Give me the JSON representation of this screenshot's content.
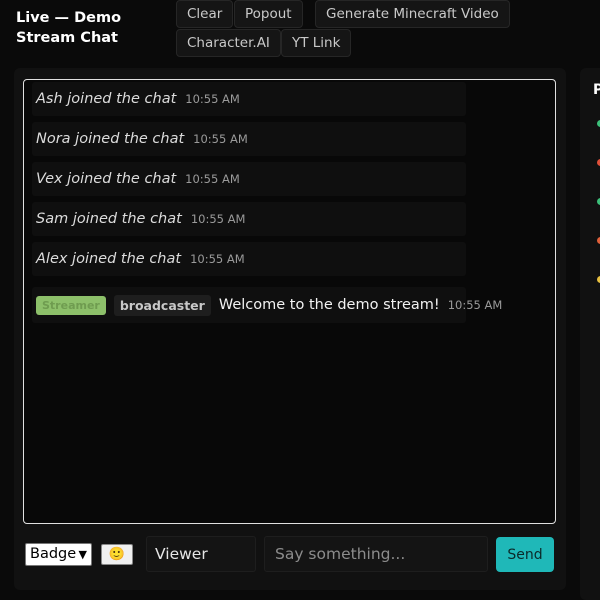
{
  "header": {
    "title": "Live — Demo Stream Chat",
    "buttons": [
      "Clear",
      "Popout",
      "Generate Minecraft Video",
      "Character.AI",
      "YT Link"
    ]
  },
  "chat": {
    "join_messages": [
      {
        "text": "Ash joined the chat",
        "time": "10:55 AM"
      },
      {
        "text": "Nora joined the chat",
        "time": "10:55 AM"
      },
      {
        "text": "Vex joined the chat",
        "time": "10:55 AM"
      },
      {
        "text": "Sam joined the chat",
        "time": "10:55 AM"
      },
      {
        "text": "Alex joined the chat",
        "time": "10:55 AM"
      }
    ],
    "broadcast": {
      "badge": "Streamer",
      "role": "broadcaster",
      "text": "Welcome to the demo stream!",
      "time": "10:55 AM"
    }
  },
  "composer": {
    "badge_select": "Badge",
    "emoji": "🙂",
    "name_value": "Viewer",
    "message_placeholder": "Say something...",
    "send_label": "Send"
  },
  "side_panel": {
    "heading": "P",
    "status_colors": [
      "#3cc07a",
      "#e0503a",
      "#3cc07a",
      "#e0603a",
      "#e8c040"
    ]
  },
  "colors": {
    "accent": "#1fb8b8",
    "streamer_badge": "#8dc06a"
  }
}
